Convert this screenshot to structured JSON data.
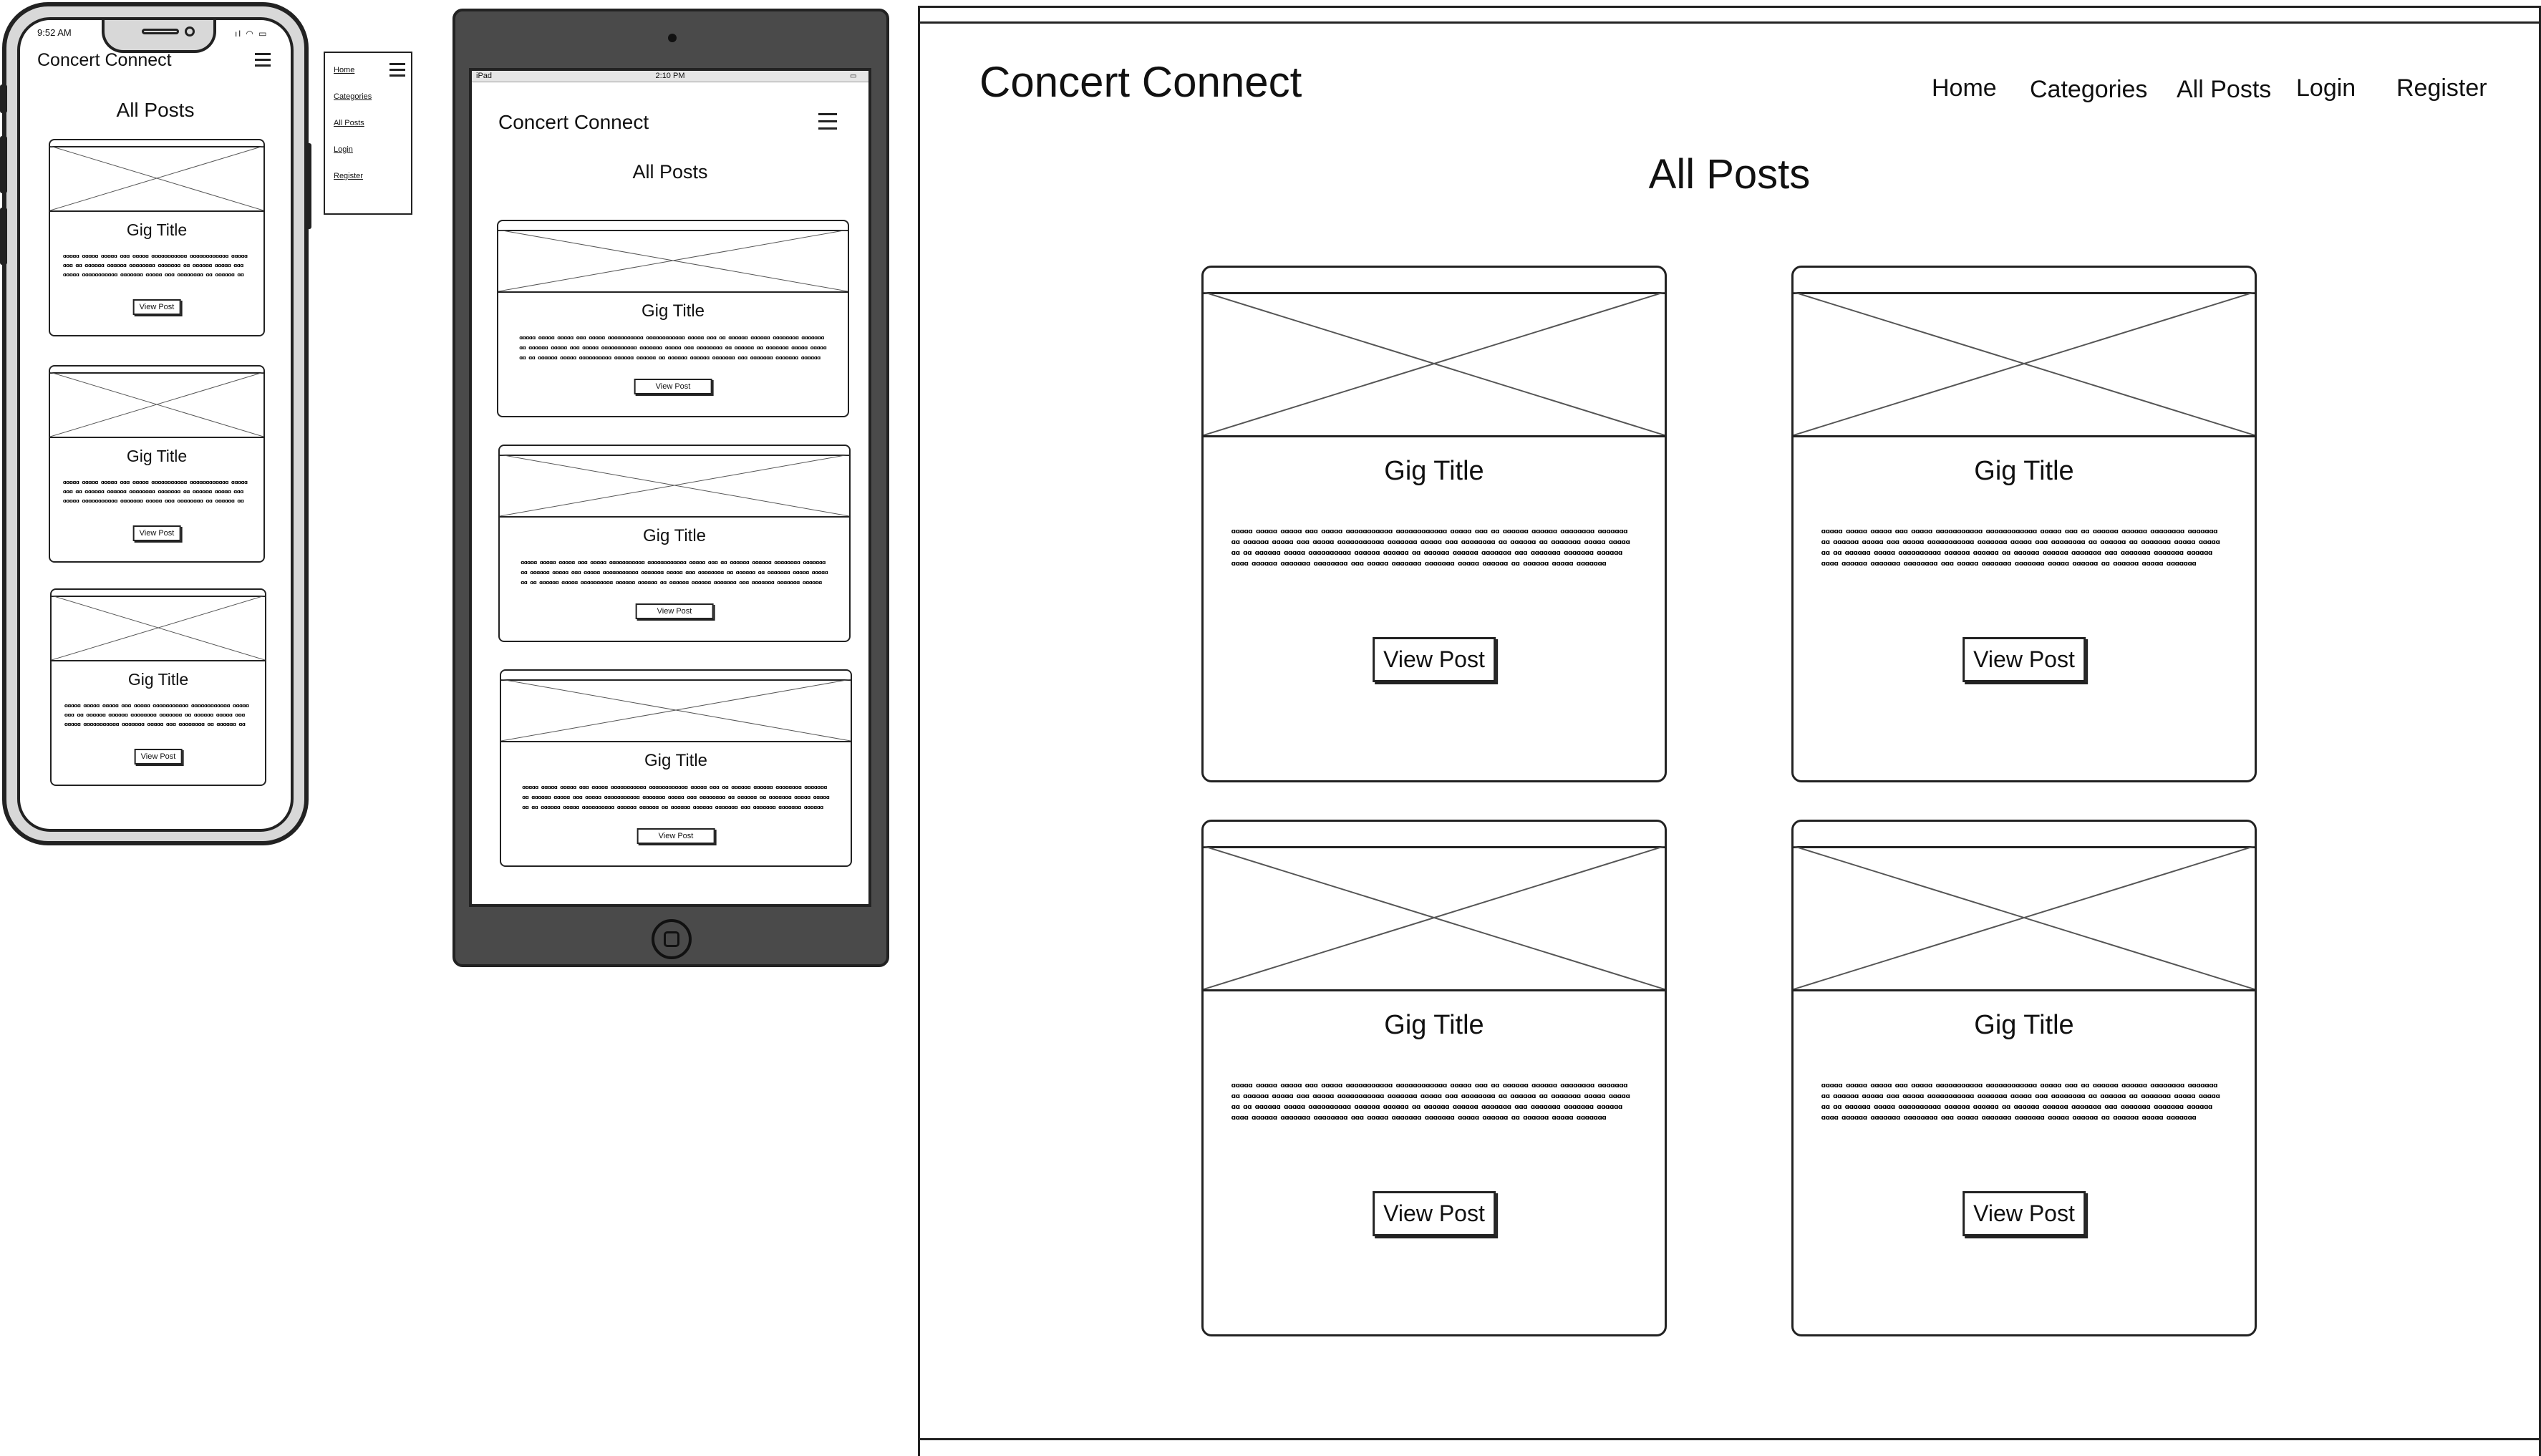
{
  "brand": "Concert Connect",
  "page_title": "All Posts",
  "card": {
    "title": "Gig Title",
    "button": "View Post",
    "lorem": "ɑɑɑɑɑ ɑɑɑɑɑ ɑɑɑɑɑ ɑɑɑ ɑɑɑɑɑ ɑɑɑɑɑɑɑɑɑɑɑ ɑɑɑɑɑɑɑɑɑɑɑɑ ɑɑɑɑɑ ɑɑɑ ɑɑ ɑɑɑɑɑɑ ɑɑɑɑɑɑ ɑɑɑɑɑɑɑɑ ɑɑɑɑɑɑɑ ɑɑ ɑɑɑɑɑɑ ɑɑɑɑɑ ɑɑɑ ɑɑɑɑɑ ɑɑɑɑɑɑɑɑɑɑɑ ɑɑɑɑɑɑɑ ɑɑɑɑɑ ɑɑɑ ɑɑɑɑɑɑɑɑ ɑɑ ɑɑɑɑɑɑ ɑɑ ɑɑɑɑɑɑɑ ɑɑɑɑɑ ɑɑɑɑɑ ɑɑ ɑɑ ɑɑɑɑɑɑ ɑɑɑɑɑ ɑɑɑɑɑɑɑɑɑɑ ɑɑɑɑɑɑ ɑɑɑɑɑɑ ɑɑ ɑɑɑɑɑɑ ɑɑɑɑɑɑ ɑɑɑɑɑɑɑ ɑɑɑ ɑɑɑɑɑɑɑ ɑɑɑɑɑɑɑ ɑɑɑɑɑɑ ɑɑɑɑ ɑɑɑɑɑɑ ɑɑɑɑɑɑɑ ɑɑɑɑɑɑɑɑ ɑɑɑ ɑɑɑɑɑ ɑɑɑɑɑɑɑ ɑɑɑɑɑɑɑ ɑɑɑɑɑ ɑɑɑɑɑɑ ɑɑ ɑɑɑɑɑɑ ɑɑɑɑɑ ɑɑɑɑɑɑɑ"
  },
  "mobile": {
    "status_time": "9:52 AM",
    "menu": [
      "Home",
      "Categories",
      "All Posts",
      "Login",
      "Register"
    ]
  },
  "tablet": {
    "status_left": "iPad",
    "status_time": "2:10 PM"
  },
  "desktop": {
    "nav": [
      "Home",
      "Categories",
      "All Posts",
      "Login",
      "Register"
    ]
  },
  "icons": {
    "menu": "hamburger-icon",
    "placeholder": "image-placeholder-icon",
    "home_button": "home-button-icon"
  },
  "colors": {
    "ink": "#222222",
    "tablet_body": "#4a4a4a",
    "phone_body": "#d8d8d8"
  }
}
